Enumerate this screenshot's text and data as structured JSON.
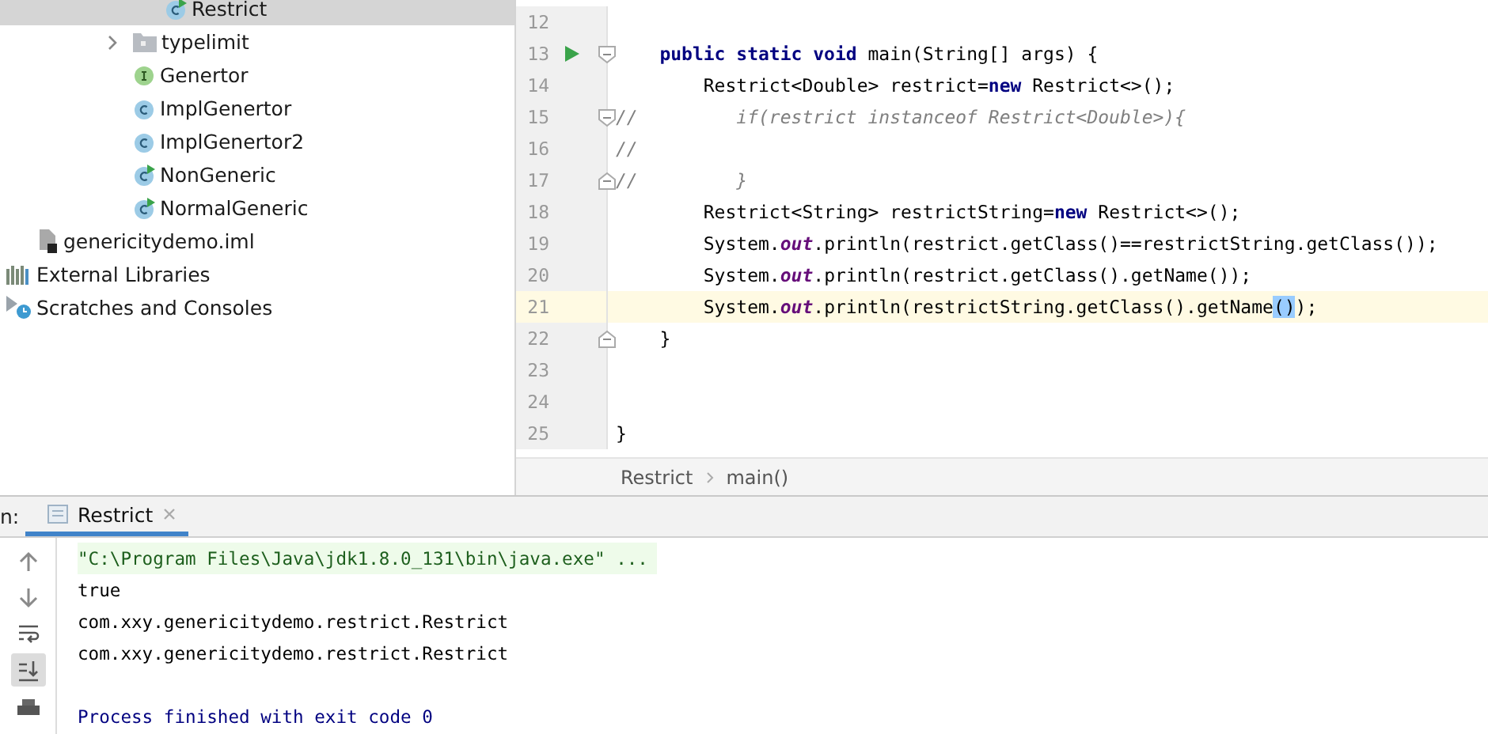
{
  "project_tree": {
    "items": [
      {
        "children": [
          {
            "children": [
              {
                "children": [
                  {
                    "children": [
                      {
                        "children": [
                          {
                            "label": "Restrict",
                            "kind": "class-runnable",
                            "selected": true
                          }
                        ]
                      },
                      {
                        "label": "typelimit",
                        "kind": "folder",
                        "expanded": false,
                        "selected": false
                      },
                      {
                        "label": "Genertor",
                        "kind": "interface",
                        "selected": false
                      },
                      {
                        "label": "ImplGenertor",
                        "kind": "class",
                        "selected": false
                      },
                      {
                        "label": "ImplGenertor2",
                        "kind": "class",
                        "selected": false
                      },
                      {
                        "label": "NonGeneric",
                        "kind": "class-runnable",
                        "selected": false
                      },
                      {
                        "label": "NormalGeneric",
                        "kind": "class-runnable",
                        "selected": false
                      }
                    ]
                  }
                ]
              }
            ]
          },
          {
            "label": "genericitydemo.iml",
            "kind": "module-file",
            "selected": false
          }
        ]
      },
      {
        "label": "External Libraries",
        "kind": "libraries",
        "selected": false
      },
      {
        "label": "Scratches and Consoles",
        "kind": "scratches",
        "selected": false
      }
    ]
  },
  "editor": {
    "lines": [
      {
        "number": "12",
        "current": false
      },
      {
        "number": "13",
        "current": false,
        "run": true,
        "fold_start": true,
        "segments": [
          {
            "kind": "keyword",
            "text": "    public static void"
          },
          {
            "kind": "plain",
            "text": " main(String[] args) {"
          }
        ]
      },
      {
        "number": "14",
        "current": false,
        "segments": [
          {
            "kind": "plain",
            "text": "        Restrict<Double> restrict="
          },
          {
            "kind": "keyword",
            "text": "new"
          },
          {
            "kind": "plain",
            "text": " Restrict<>();"
          }
        ]
      },
      {
        "number": "15",
        "current": false,
        "fold_start": true,
        "segments": [
          {
            "kind": "comment",
            "text": "//         if(restrict instanceof Restrict<Double>){"
          }
        ]
      },
      {
        "number": "16",
        "current": false,
        "segments": [
          {
            "kind": "comment",
            "text": "//"
          }
        ]
      },
      {
        "number": "17",
        "current": false,
        "fold_end": true,
        "segments": [
          {
            "kind": "comment",
            "text": "//         }"
          }
        ]
      },
      {
        "number": "18",
        "current": false,
        "segments": [
          {
            "kind": "plain",
            "text": "        Restrict<String> restrictString="
          },
          {
            "kind": "keyword",
            "text": "new"
          },
          {
            "kind": "plain",
            "text": " Restrict<>();"
          }
        ]
      },
      {
        "number": "19",
        "current": false,
        "segments": [
          {
            "kind": "plain",
            "text": "        System."
          },
          {
            "kind": "field",
            "text": "out"
          },
          {
            "kind": "plain",
            "text": ".println(restrict.getClass()==restrictString.getClass());"
          }
        ]
      },
      {
        "number": "20",
        "current": false,
        "segments": [
          {
            "kind": "plain",
            "text": "        System."
          },
          {
            "kind": "field",
            "text": "out"
          },
          {
            "kind": "plain",
            "text": ".println(restrict.getClass().getName());"
          }
        ]
      },
      {
        "number": "21",
        "current": true,
        "segments": [
          {
            "kind": "plain",
            "text": "        System."
          },
          {
            "kind": "field",
            "text": "out"
          },
          {
            "kind": "plain",
            "text": ".println(restrictString.getClass().getName"
          },
          {
            "kind": "match",
            "text": "()"
          },
          {
            "kind": "plain",
            "text": ");"
          }
        ]
      },
      {
        "number": "22",
        "current": false,
        "fold_end": true,
        "segments": [
          {
            "kind": "plain",
            "text": "    }"
          }
        ]
      },
      {
        "number": "23",
        "current": false
      },
      {
        "number": "24",
        "current": false
      },
      {
        "number": "25",
        "current": false,
        "segments": [
          {
            "kind": "plain",
            "text": "}"
          }
        ]
      }
    ],
    "breadcrumbs": [
      "Restrict",
      "main()"
    ]
  },
  "run_panel": {
    "label": "n:",
    "tabs": [
      {
        "label": "Restrict",
        "selected": true
      }
    ],
    "toolbar": [
      {
        "kind": "up",
        "on": false
      },
      {
        "kind": "down",
        "on": false
      },
      {
        "kind": "wrap",
        "on": false
      },
      {
        "kind": "scroll-end",
        "on": true
      },
      {
        "kind": "print",
        "on": false
      }
    ],
    "console": [
      {
        "kind": "command",
        "text": "\"C:\\Program Files\\Java\\jdk1.8.0_131\\bin\\java.exe\" ..."
      },
      {
        "kind": "output",
        "text": "true"
      },
      {
        "kind": "output",
        "text": "com.xxy.genericitydemo.restrict.Restrict"
      },
      {
        "kind": "output",
        "text": "com.xxy.genericitydemo.restrict.Restrict"
      },
      {
        "kind": "status",
        "text": "Process finished with exit code 0"
      }
    ]
  }
}
